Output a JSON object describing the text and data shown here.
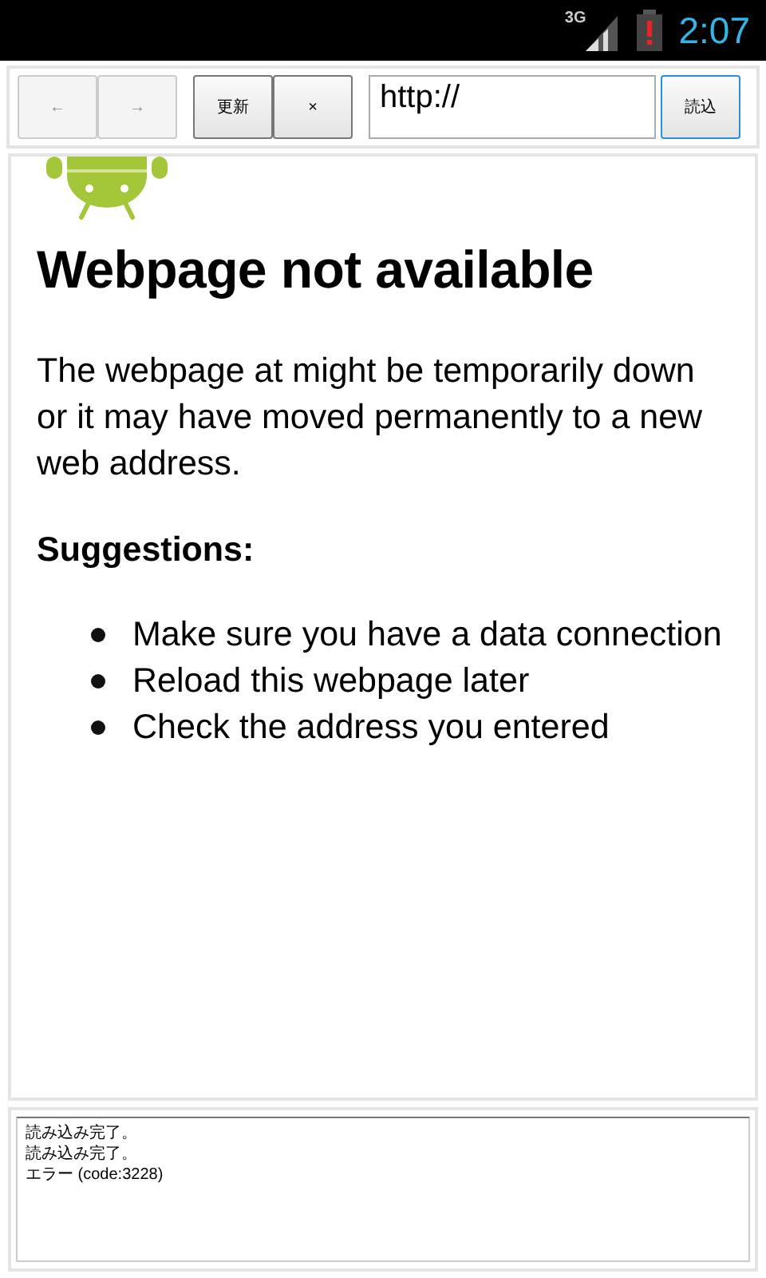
{
  "status_bar": {
    "network": "3G",
    "time": "2:07"
  },
  "toolbar": {
    "buttons": [
      {
        "label": "←",
        "disabled": true,
        "focused": false
      },
      {
        "label": "→",
        "disabled": true,
        "focused": false
      },
      {
        "label": "更新",
        "disabled": false,
        "focused": false
      },
      {
        "label": "×",
        "disabled": false,
        "focused": false
      }
    ],
    "url_field": {
      "value": "http://"
    },
    "load_button": {
      "label": "読込",
      "disabled": false,
      "focused": true
    }
  },
  "page": {
    "title": "Webpage not available",
    "message": "The webpage at might be temporarily down or it may have moved permanently to a new web address.",
    "suggestions_heading": "Suggestions:",
    "suggestions": [
      "Make sure you have a data connection",
      "Reload this webpage later",
      "Check the address you entered"
    ]
  },
  "log": {
    "lines": [
      "読み込み完了。",
      "読み込み完了。",
      "エラー (code:3228)"
    ]
  }
}
